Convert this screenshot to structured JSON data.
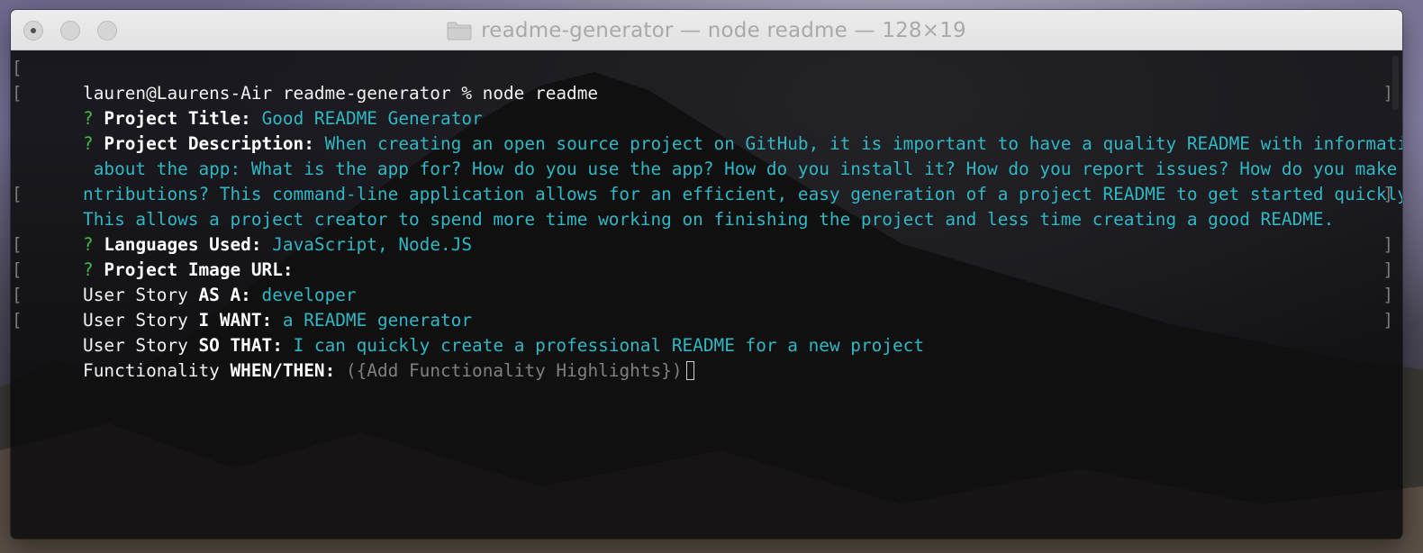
{
  "window": {
    "title": "readme-generator — node readme — 128×19"
  },
  "terminal": {
    "prompt_line": "lauren@Laurens-Air readme-generator % node readme",
    "entries": [
      {
        "q": "?",
        "label": "Project Title:",
        "answer": "Good README Generator"
      },
      {
        "q": "?",
        "label": "Project Description:",
        "answer_lines": [
          "When creating an open source project on GitHub, it is important to have a quality README with information",
          " about the app: What is the app for? How do you use the app? How do you install it? How do you report issues? How do you make co",
          "ntributions? This command-line application allows for an efficient, easy generation of a project README to get started quickly.",
          "This allows a project creator to spend more time working on finishing the project and less time creating a good README."
        ]
      },
      {
        "q": "?",
        "label": "Languages Used:",
        "answer": "JavaScript, Node.JS"
      },
      {
        "q": "?",
        "label": "Project Image URL:",
        "answer": ""
      },
      {
        "prefix": "User Story ",
        "label": "AS A:",
        "answer": "developer"
      },
      {
        "prefix": "User Story ",
        "label": "I WANT:",
        "answer": "a README generator"
      },
      {
        "prefix": "User Story ",
        "label": "SO THAT:",
        "answer": "I can quickly create a professional README for a new project"
      },
      {
        "prefix": "Functionality ",
        "label": "WHEN/THEN:",
        "placeholder": "({Add Functionality Highlights})"
      }
    ]
  },
  "colors": {
    "question_mark": "#3fba3f",
    "answer": "#2fb7c4",
    "placeholder": "#808080",
    "terminal_bg": "#0a0a0c"
  },
  "icons": {
    "title_folder": "folder-icon",
    "cursor": "block-cursor"
  }
}
